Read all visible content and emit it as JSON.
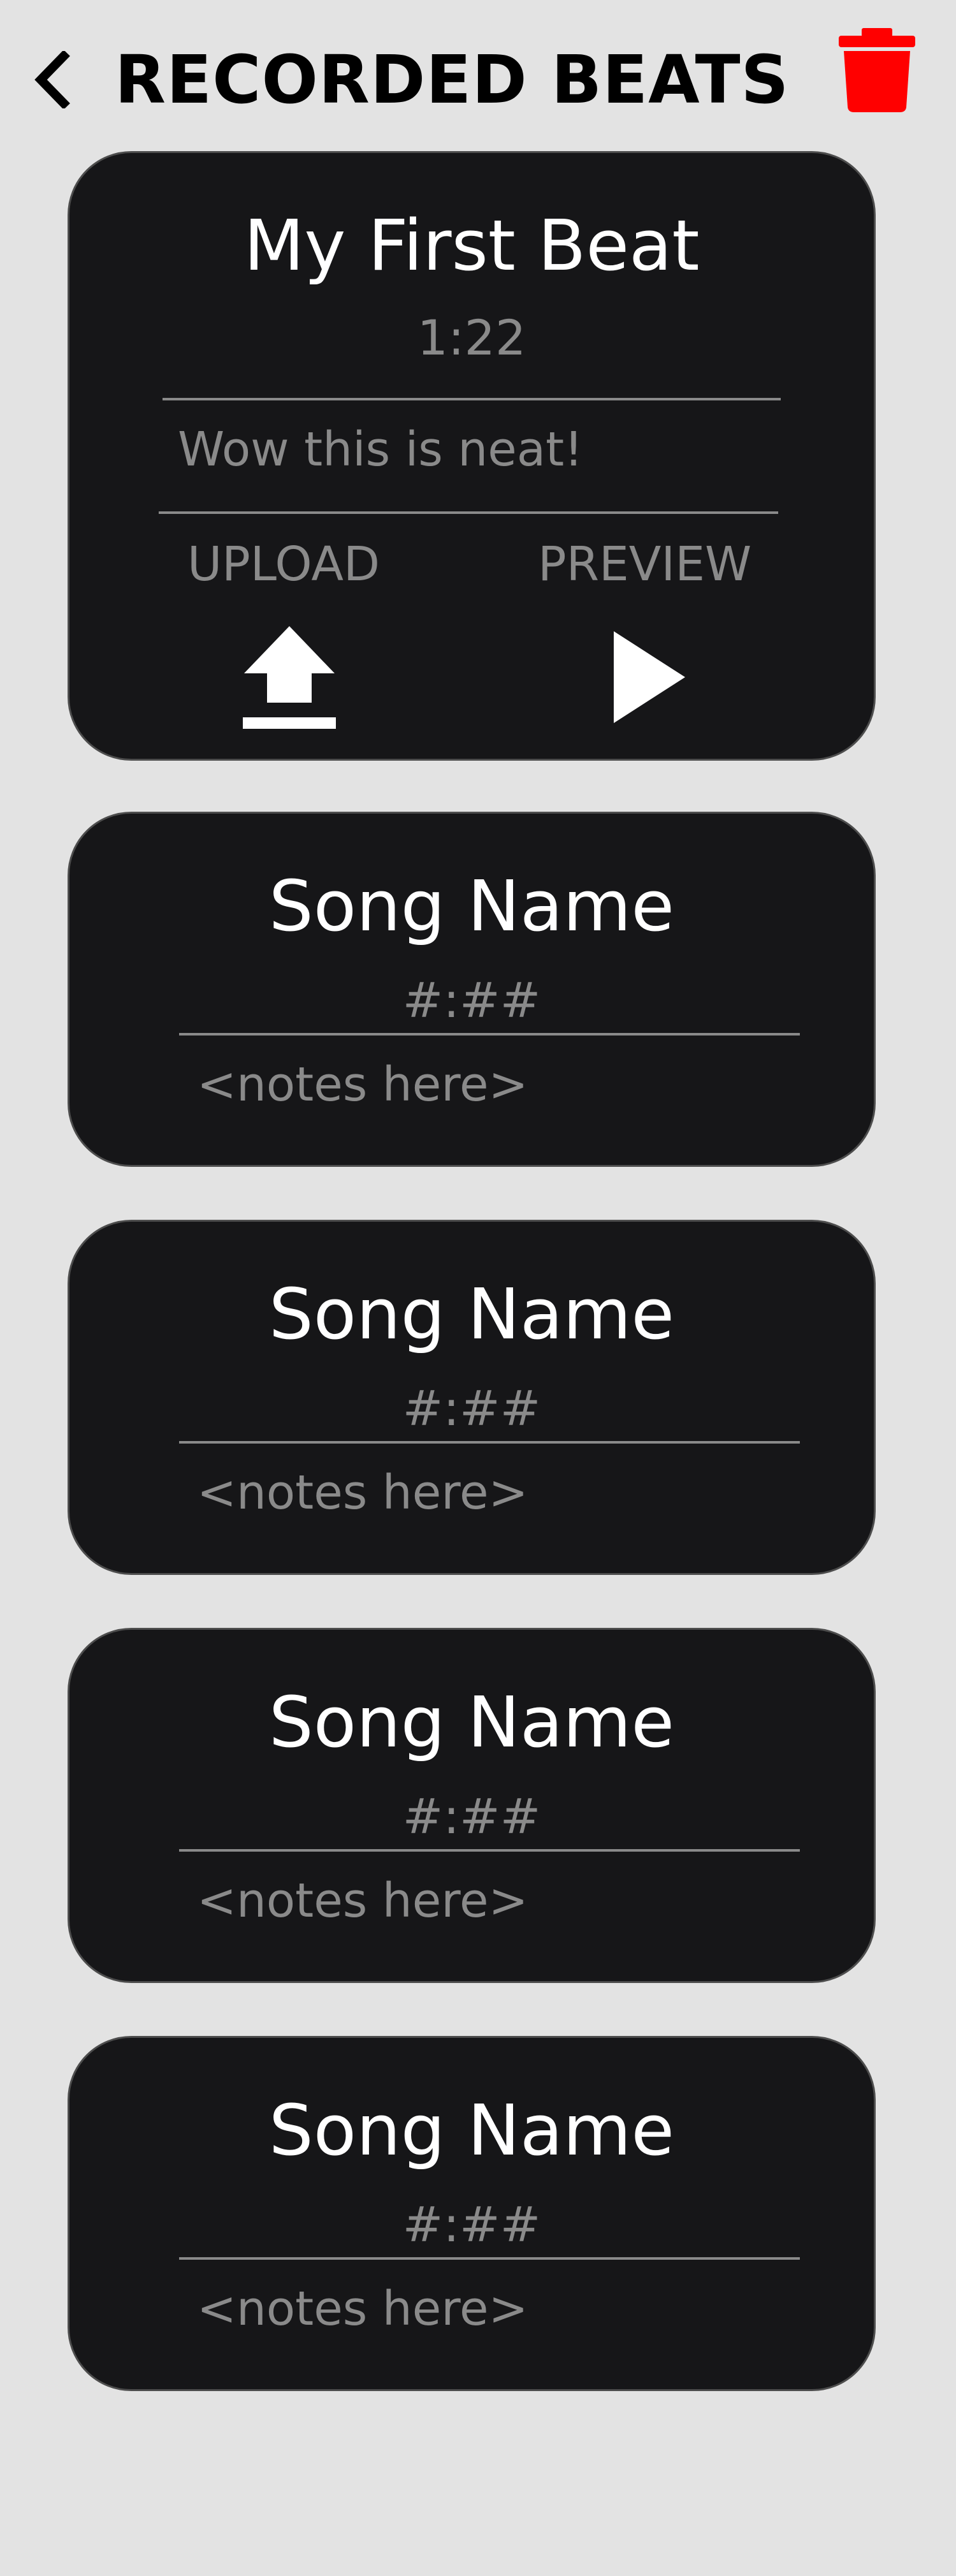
{
  "header": {
    "back_icon": "chevron-left-icon",
    "title": "RECORDED BEATS",
    "trash_icon": "trash-icon",
    "trash_color": "#ff0000"
  },
  "beats": [
    {
      "name": "My First Beat",
      "duration": "1:22",
      "notes": "Wow this is neat!",
      "expanded": true,
      "actions": {
        "upload_label": "UPLOAD",
        "upload_icon": "upload-icon",
        "preview_label": "PREVIEW",
        "preview_icon": "play-icon"
      }
    },
    {
      "name": "Song Name",
      "duration": "#:##",
      "notes": "<notes here>",
      "expanded": false
    },
    {
      "name": "Song Name",
      "duration": "#:##",
      "notes": "<notes here>",
      "expanded": false
    },
    {
      "name": "Song Name",
      "duration": "#:##",
      "notes": "<notes here>",
      "expanded": false
    },
    {
      "name": "Song Name",
      "duration": "#:##",
      "notes": "<notes here>",
      "expanded": false
    }
  ],
  "colors": {
    "background": "#e3e3e3",
    "card": "#161618",
    "text_primary": "#ffffff",
    "text_secondary": "#8a8a8a"
  }
}
